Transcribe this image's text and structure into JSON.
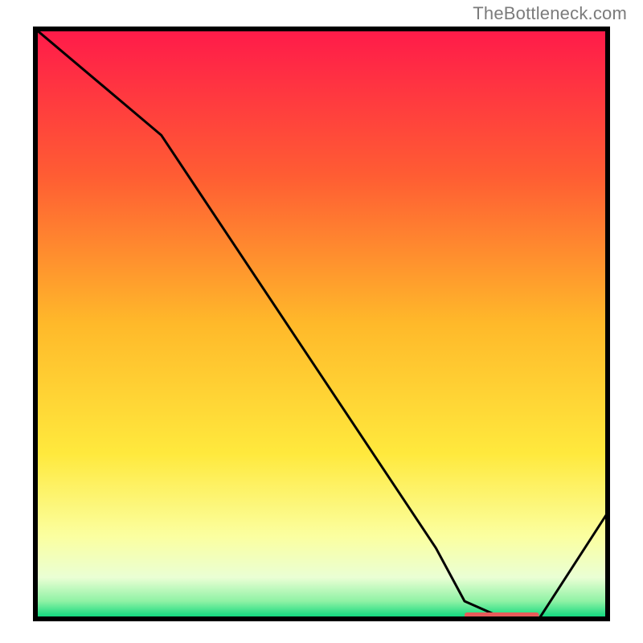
{
  "attribution": "TheBottleneck.com",
  "chart_data": {
    "type": "line",
    "title": "",
    "xlabel": "",
    "ylabel": "",
    "xlim": [
      0,
      100
    ],
    "ylim": [
      0,
      100
    ],
    "x": [
      0,
      22,
      70,
      75,
      82,
      88,
      100
    ],
    "values": [
      100,
      82,
      12,
      3,
      0,
      0,
      18
    ],
    "annotation_x_range": [
      75,
      88
    ],
    "gradient_stops": [
      {
        "offset": 0.0,
        "color": "#ff1a4a"
      },
      {
        "offset": 0.25,
        "color": "#ff5d33"
      },
      {
        "offset": 0.5,
        "color": "#ffb92a"
      },
      {
        "offset": 0.72,
        "color": "#ffe93d"
      },
      {
        "offset": 0.86,
        "color": "#fbffa0"
      },
      {
        "offset": 0.93,
        "color": "#eaffd4"
      },
      {
        "offset": 0.97,
        "color": "#8ff2a5"
      },
      {
        "offset": 1.0,
        "color": "#00d67a"
      }
    ],
    "marker": {
      "color": "#e85a5a",
      "shape": "horizontal-bar"
    },
    "frame_color": "#000000",
    "outside_color": "#ffffff"
  }
}
